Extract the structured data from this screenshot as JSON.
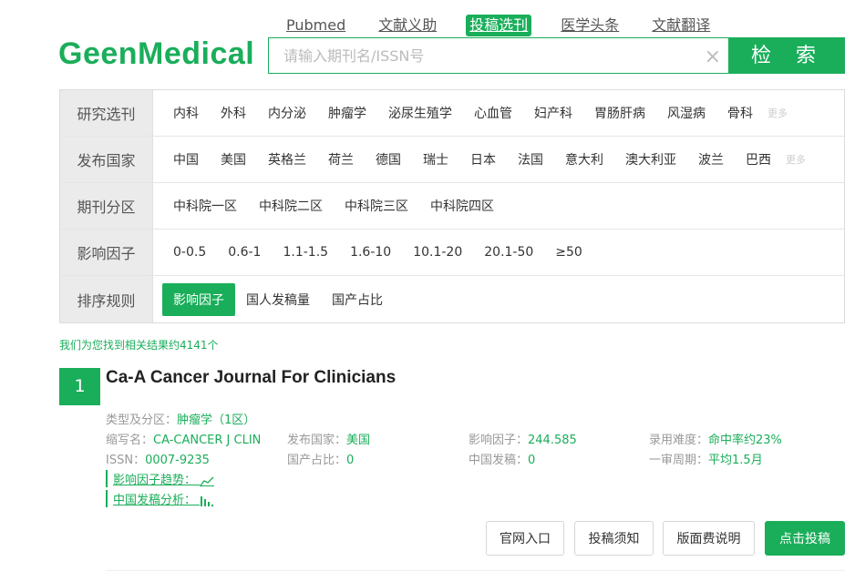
{
  "nav": [
    "Pubmed",
    "文献义助",
    "投稿选刊",
    "医学头条",
    "文献翻译"
  ],
  "nav_active_index": 2,
  "logo": "GeenMedical",
  "search": {
    "placeholder": "请输入期刊名/ISSN号",
    "clear": "×",
    "button": "检 索"
  },
  "filters": [
    {
      "label": "研究选刊",
      "options": [
        "内科",
        "外科",
        "内分泌",
        "肿瘤学",
        "泌尿生殖学",
        "心血管",
        "妇产科",
        "胃肠肝病",
        "风湿病",
        "骨科"
      ],
      "more": "更多"
    },
    {
      "label": "发布国家",
      "options": [
        "中国",
        "美国",
        "英格兰",
        "荷兰",
        "德国",
        "瑞士",
        "日本",
        "法国",
        "意大利",
        "澳大利亚",
        "波兰",
        "巴西"
      ],
      "more": "更多"
    },
    {
      "label": "期刊分区",
      "options": [
        "中科院一区",
        "中科院二区",
        "中科院三区",
        "中科院四区"
      ]
    },
    {
      "label": "影响因子",
      "options": [
        "0-0.5",
        "0.6-1",
        "1.1-1.5",
        "1.6-10",
        "10.1-20",
        "20.1-50",
        "≥50"
      ]
    },
    {
      "label": "排序规则",
      "options": [
        "影响因子",
        "国人发稿量",
        "国产占比"
      ],
      "active": 0
    }
  ],
  "results": {
    "count_text": "我们为您找到相关结果约4141个",
    "item": {
      "index": "1",
      "title": "Ca-A Cancer Journal For Clinicians",
      "type_label": "类型及分区：",
      "type_value": "肿瘤学（1区）",
      "abbr_label": "缩写名：",
      "abbr_value": "CA-CANCER J CLIN",
      "country_label": "发布国家：",
      "country_value": "美国",
      "if_label": "影响因子：",
      "if_value": "244.585",
      "diff_label": "录用难度：",
      "diff_value": "命中率约23%",
      "issn_label": "ISSN：",
      "issn_value": "0007-9235",
      "domestic_label": "国产占比：",
      "domestic_value": "0",
      "china_label": "中国发稿：",
      "china_value": "0",
      "review_label": "一审周期：",
      "review_value": "平均1.5月",
      "trend_link": "影响因子趋势：",
      "china_link": "中国发稿分析："
    },
    "buttons": [
      "官网入口",
      "投稿须知",
      "版面费说明",
      "点击投稿"
    ]
  },
  "colors": {
    "accent": "#1aae5a"
  }
}
